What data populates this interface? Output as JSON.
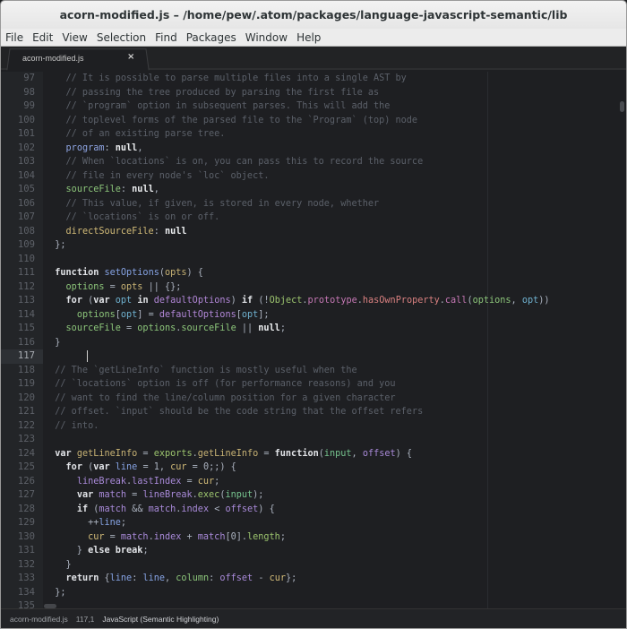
{
  "window": {
    "title": "acorn-modified.js – /home/pew/.atom/packages/language-javascript-semantic/lib"
  },
  "menu": [
    "File",
    "Edit",
    "View",
    "Selection",
    "Find",
    "Packages",
    "Window",
    "Help"
  ],
  "tab": {
    "label": "acorn-modified.js",
    "close": "×"
  },
  "status": {
    "file": "acorn-modified.js",
    "cursor": "117,1",
    "grammar": "JavaScript (Semantic Highlighting)"
  },
  "current_line": "117",
  "palette": {
    "c": "#5b6069",
    "k": "#e2e4e8",
    "p": "#abb2bf",
    "n": "#eceef0",
    "b": "#8ea4e2",
    "g": "#8cc57a",
    "y": "#d2bb78",
    "t": "#c7b274",
    "s": "#6fb1cf",
    "v": "#b287d8",
    "o": "#9cc46e",
    "r": "#c678b5",
    "h": "#d98080",
    "m": "#a98ad9",
    "i": "#76c38e",
    "l": "#86a3e4"
  },
  "lines": [
    {
      "n": "97",
      "t": [
        [
          "c",
          "    // It is possible to parse multiple files into a single AST by"
        ]
      ]
    },
    {
      "n": "98",
      "t": [
        [
          "c",
          "    // passing the tree produced by parsing the first file as"
        ]
      ]
    },
    {
      "n": "99",
      "t": [
        [
          "c",
          "    // `program` option in subsequent parses. This will add the"
        ]
      ]
    },
    {
      "n": "100",
      "t": [
        [
          "c",
          "    // toplevel forms of the parsed file to the `Program` (top) node"
        ]
      ]
    },
    {
      "n": "101",
      "t": [
        [
          "c",
          "    // of an existing parse tree."
        ]
      ]
    },
    {
      "n": "102",
      "t": [
        [
          "p",
          "    "
        ],
        [
          "b",
          "program"
        ],
        [
          "p",
          ": "
        ],
        [
          "n",
          "null"
        ],
        [
          "p",
          ","
        ]
      ]
    },
    {
      "n": "103",
      "t": [
        [
          "c",
          "    // When `locations` is on, you can pass this to record the source"
        ]
      ]
    },
    {
      "n": "104",
      "t": [
        [
          "c",
          "    // file in every node's `loc` object."
        ]
      ]
    },
    {
      "n": "105",
      "t": [
        [
          "p",
          "    "
        ],
        [
          "g",
          "sourceFile"
        ],
        [
          "p",
          ": "
        ],
        [
          "n",
          "null"
        ],
        [
          "p",
          ","
        ]
      ]
    },
    {
      "n": "106",
      "t": [
        [
          "c",
          "    // This value, if given, is stored in every node, whether"
        ]
      ]
    },
    {
      "n": "107",
      "t": [
        [
          "c",
          "    // `locations` is on or off."
        ]
      ]
    },
    {
      "n": "108",
      "t": [
        [
          "p",
          "    "
        ],
        [
          "y",
          "directSourceFile"
        ],
        [
          "p",
          ": "
        ],
        [
          "n",
          "null"
        ]
      ]
    },
    {
      "n": "109",
      "t": [
        [
          "p",
          "  };"
        ]
      ]
    },
    {
      "n": "110",
      "t": []
    },
    {
      "n": "111",
      "t": [
        [
          "p",
          "  "
        ],
        [
          "k",
          "function"
        ],
        [
          "p",
          " "
        ],
        [
          "l",
          "setOptions"
        ],
        [
          "p",
          "("
        ],
        [
          "t",
          "opts"
        ],
        [
          "p",
          ") {"
        ]
      ]
    },
    {
      "n": "112",
      "t": [
        [
          "p",
          "    "
        ],
        [
          "g",
          "options"
        ],
        [
          "p",
          " = "
        ],
        [
          "t",
          "opts"
        ],
        [
          "p",
          " || {};"
        ]
      ]
    },
    {
      "n": "113",
      "t": [
        [
          "p",
          "    "
        ],
        [
          "k",
          "for"
        ],
        [
          "p",
          " ("
        ],
        [
          "k",
          "var"
        ],
        [
          "p",
          " "
        ],
        [
          "s",
          "opt"
        ],
        [
          "p",
          " "
        ],
        [
          "k",
          "in"
        ],
        [
          "p",
          " "
        ],
        [
          "v",
          "defaultOptions"
        ],
        [
          "p",
          ") "
        ],
        [
          "k",
          "if"
        ],
        [
          "p",
          " (!"
        ],
        [
          "o",
          "Object"
        ],
        [
          "p",
          "."
        ],
        [
          "r",
          "prototype"
        ],
        [
          "p",
          "."
        ],
        [
          "h",
          "hasOwnProperty"
        ],
        [
          "p",
          "."
        ],
        [
          "r",
          "call"
        ],
        [
          "p",
          "("
        ],
        [
          "g",
          "options"
        ],
        [
          "p",
          ", "
        ],
        [
          "s",
          "opt"
        ],
        [
          "p",
          "))"
        ]
      ]
    },
    {
      "n": "114",
      "t": [
        [
          "p",
          "      "
        ],
        [
          "g",
          "options"
        ],
        [
          "p",
          "["
        ],
        [
          "s",
          "opt"
        ],
        [
          "p",
          "] = "
        ],
        [
          "v",
          "defaultOptions"
        ],
        [
          "p",
          "["
        ],
        [
          "s",
          "opt"
        ],
        [
          "p",
          "];"
        ]
      ]
    },
    {
      "n": "115",
      "t": [
        [
          "p",
          "    "
        ],
        [
          "g",
          "sourceFile"
        ],
        [
          "p",
          " = "
        ],
        [
          "g",
          "options"
        ],
        [
          "p",
          "."
        ],
        [
          "g",
          "sourceFile"
        ],
        [
          "p",
          " || "
        ],
        [
          "n",
          "null"
        ],
        [
          "p",
          ";"
        ]
      ]
    },
    {
      "n": "116",
      "t": [
        [
          "p",
          "  }"
        ]
      ]
    },
    {
      "n": "117",
      "t": []
    },
    {
      "n": "118",
      "t": [
        [
          "c",
          "  // The `getLineInfo` function is mostly useful when the"
        ]
      ]
    },
    {
      "n": "119",
      "t": [
        [
          "c",
          "  // `locations` option is off (for performance reasons) and you"
        ]
      ]
    },
    {
      "n": "120",
      "t": [
        [
          "c",
          "  // want to find the line/column position for a given character"
        ]
      ]
    },
    {
      "n": "121",
      "t": [
        [
          "c",
          "  // offset. `input` should be the code string that the offset refers"
        ]
      ]
    },
    {
      "n": "122",
      "t": [
        [
          "c",
          "  // into."
        ]
      ]
    },
    {
      "n": "123",
      "t": []
    },
    {
      "n": "124",
      "t": [
        [
          "p",
          "  "
        ],
        [
          "k",
          "var"
        ],
        [
          "p",
          " "
        ],
        [
          "t",
          "getLineInfo"
        ],
        [
          "p",
          " = "
        ],
        [
          "o",
          "exports"
        ],
        [
          "p",
          "."
        ],
        [
          "t",
          "getLineInfo"
        ],
        [
          "p",
          " = "
        ],
        [
          "k",
          "function"
        ],
        [
          "p",
          "("
        ],
        [
          "i",
          "input"
        ],
        [
          "p",
          ", "
        ],
        [
          "m",
          "offset"
        ],
        [
          "p",
          ") {"
        ]
      ]
    },
    {
      "n": "125",
      "t": [
        [
          "p",
          "    "
        ],
        [
          "k",
          "for"
        ],
        [
          "p",
          " ("
        ],
        [
          "k",
          "var"
        ],
        [
          "p",
          " "
        ],
        [
          "l",
          "line"
        ],
        [
          "p",
          " = 1, "
        ],
        [
          "y",
          "cur"
        ],
        [
          "p",
          " = 0;;) {"
        ]
      ]
    },
    {
      "n": "126",
      "t": [
        [
          "p",
          "      "
        ],
        [
          "m",
          "lineBreak"
        ],
        [
          "p",
          "."
        ],
        [
          "m",
          "lastIndex"
        ],
        [
          "p",
          " = "
        ],
        [
          "y",
          "cur"
        ],
        [
          "p",
          ";"
        ]
      ]
    },
    {
      "n": "127",
      "t": [
        [
          "p",
          "      "
        ],
        [
          "k",
          "var"
        ],
        [
          "p",
          " "
        ],
        [
          "m",
          "match"
        ],
        [
          "p",
          " = "
        ],
        [
          "m",
          "lineBreak"
        ],
        [
          "p",
          "."
        ],
        [
          "o",
          "exec"
        ],
        [
          "p",
          "("
        ],
        [
          "i",
          "input"
        ],
        [
          "p",
          ");"
        ]
      ]
    },
    {
      "n": "128",
      "t": [
        [
          "p",
          "      "
        ],
        [
          "k",
          "if"
        ],
        [
          "p",
          " ("
        ],
        [
          "m",
          "match"
        ],
        [
          "p",
          " && "
        ],
        [
          "m",
          "match"
        ],
        [
          "p",
          "."
        ],
        [
          "m",
          "index"
        ],
        [
          "p",
          " < "
        ],
        [
          "m",
          "offset"
        ],
        [
          "p",
          ") {"
        ]
      ]
    },
    {
      "n": "129",
      "t": [
        [
          "p",
          "        ++"
        ],
        [
          "l",
          "line"
        ],
        [
          "p",
          ";"
        ]
      ]
    },
    {
      "n": "130",
      "t": [
        [
          "p",
          "        "
        ],
        [
          "y",
          "cur"
        ],
        [
          "p",
          " = "
        ],
        [
          "m",
          "match"
        ],
        [
          "p",
          "."
        ],
        [
          "m",
          "index"
        ],
        [
          "p",
          " + "
        ],
        [
          "m",
          "match"
        ],
        [
          "p",
          "[0]."
        ],
        [
          "o",
          "length"
        ],
        [
          "p",
          ";"
        ]
      ]
    },
    {
      "n": "131",
      "t": [
        [
          "p",
          "      } "
        ],
        [
          "k",
          "else"
        ],
        [
          "p",
          " "
        ],
        [
          "k",
          "break"
        ],
        [
          "p",
          ";"
        ]
      ]
    },
    {
      "n": "132",
      "t": [
        [
          "p",
          "    }"
        ]
      ]
    },
    {
      "n": "133",
      "t": [
        [
          "p",
          "    "
        ],
        [
          "k",
          "return"
        ],
        [
          "p",
          " {"
        ],
        [
          "l",
          "line"
        ],
        [
          "p",
          ": "
        ],
        [
          "l",
          "line"
        ],
        [
          "p",
          ", "
        ],
        [
          "g",
          "column"
        ],
        [
          "p",
          ": "
        ],
        [
          "m",
          "offset"
        ],
        [
          "p",
          " - "
        ],
        [
          "y",
          "cur"
        ],
        [
          "p",
          "};"
        ]
      ]
    },
    {
      "n": "134",
      "t": [
        [
          "p",
          "  };"
        ]
      ]
    },
    {
      "n": "135",
      "t": []
    }
  ]
}
